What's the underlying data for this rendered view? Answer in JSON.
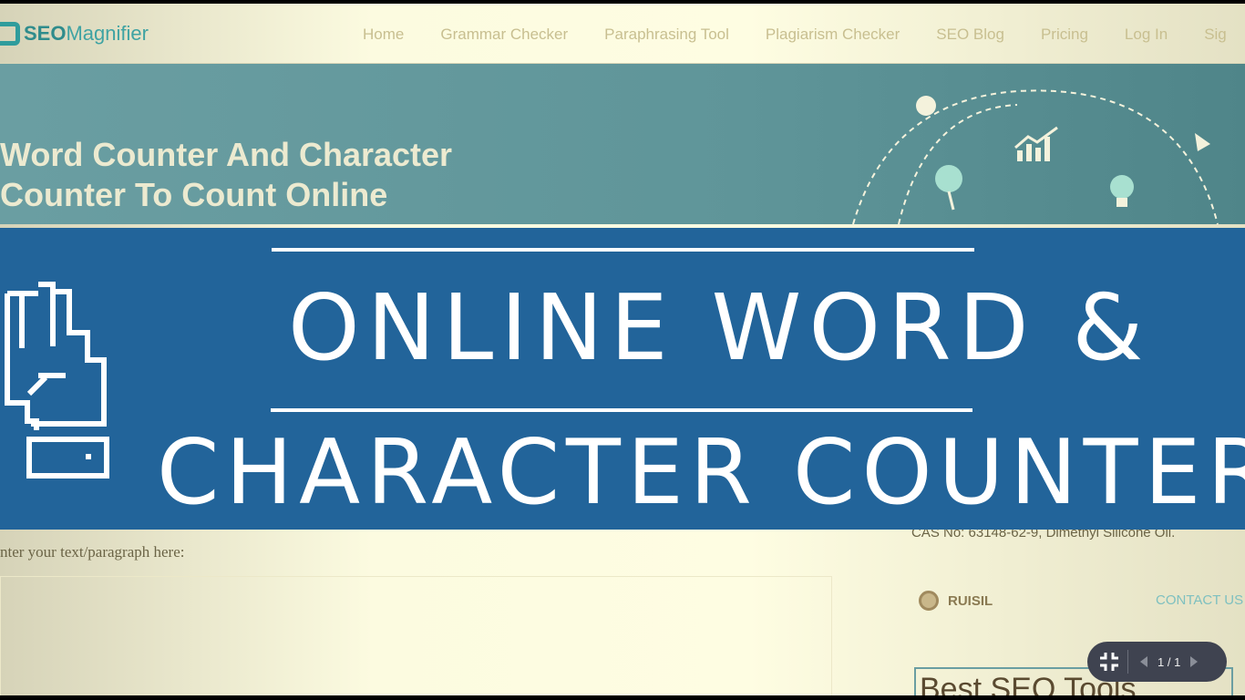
{
  "nav": {
    "logo_bold": "SEO",
    "logo_light": "Magnifier",
    "links": [
      "Home",
      "Grammar Checker",
      "Paraphrasing Tool",
      "Plagiarism Checker",
      "SEO Blog",
      "Pricing",
      "Log In",
      "Sig"
    ]
  },
  "hero": {
    "title_line1": "Word Counter And Character",
    "title_line2": "Counter To Count Online"
  },
  "banner": {
    "line1": "ONLINE WORD &",
    "line2": "CHARACTER COUNTER"
  },
  "content": {
    "input_label": "nter your text/paragraph here:",
    "cas_text": "CAS No: 63148-62-9, Dimethyl Silicone Oil.",
    "ad_brand": "RUISIL",
    "ad_contact": "CONTACT US",
    "ad_headline": "Best SEO Tools"
  },
  "viewer": {
    "page_indicator": "1 / 1"
  },
  "colors": {
    "banner": "#22649a",
    "hero": "#6a9ea2",
    "viewer_bar": "#3f4350"
  }
}
